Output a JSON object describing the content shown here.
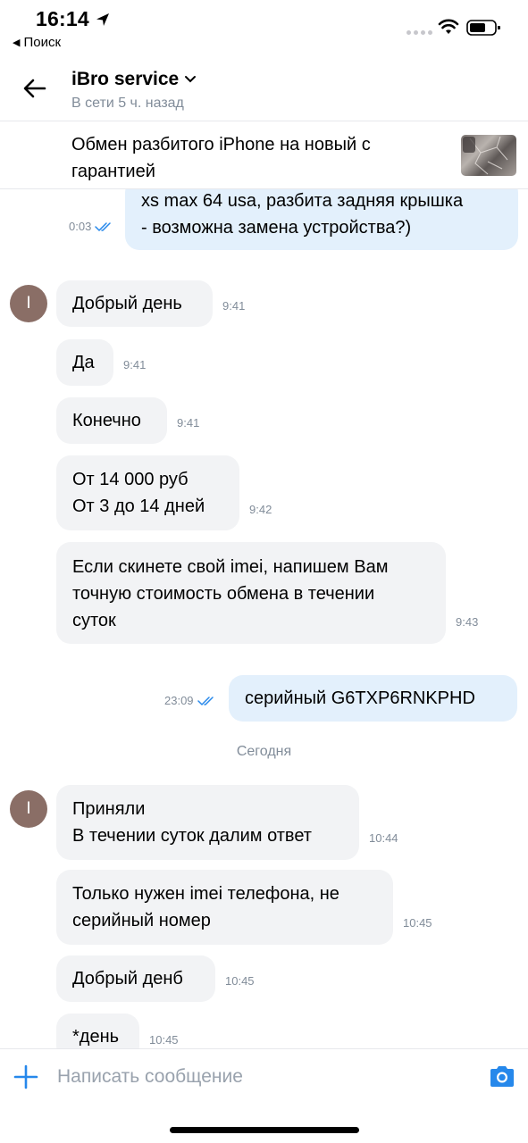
{
  "status_bar": {
    "time": "16:14",
    "back_app": "Поиск"
  },
  "header": {
    "title": "iBro service",
    "subtitle": "В сети 5 ч. назад"
  },
  "product": {
    "title": "Обмен разбитого iPhone на новый с гарантией"
  },
  "messages": [
    {
      "dir": "out",
      "text": "xs max 64 usa, разбита задняя крышка\n- возможна замена устройства?)",
      "time": "0:03"
    },
    {
      "dir": "in",
      "text": "Добрый день",
      "time": "9:41",
      "avatar": "I"
    },
    {
      "dir": "in",
      "text": "Да",
      "time": "9:41"
    },
    {
      "dir": "in",
      "text": "Конечно",
      "time": "9:41"
    },
    {
      "dir": "in",
      "text": "От 14 000 руб\nОт 3 до 14 дней",
      "time": "9:42"
    },
    {
      "dir": "in",
      "text": "Если скинете свой imei, напишем Вам\nточную стоимость обмена в течении\nсуток",
      "time": "9:43"
    },
    {
      "dir": "out",
      "text": "серийный G6TXP6RNKPHD",
      "time": "23:09"
    },
    {
      "dir": "in",
      "text": "Приняли\nВ течении суток далим ответ",
      "time": "10:44",
      "avatar": "I"
    },
    {
      "dir": "in",
      "text": "Только нужен imei телефона, не\nсерийный номер",
      "time": "10:45"
    },
    {
      "dir": "in",
      "text": "Добрый денб",
      "time": "10:45"
    },
    {
      "dir": "in",
      "text": "*день",
      "time": "10:45"
    }
  ],
  "date_separator": "Сегодня",
  "composer": {
    "placeholder": "Написать сообщение"
  },
  "colors": {
    "accent": "#2688eb",
    "incoming_bubble": "#f2f3f5",
    "outgoing_bubble": "#e3f0fc",
    "avatar": "#8a6e66"
  }
}
